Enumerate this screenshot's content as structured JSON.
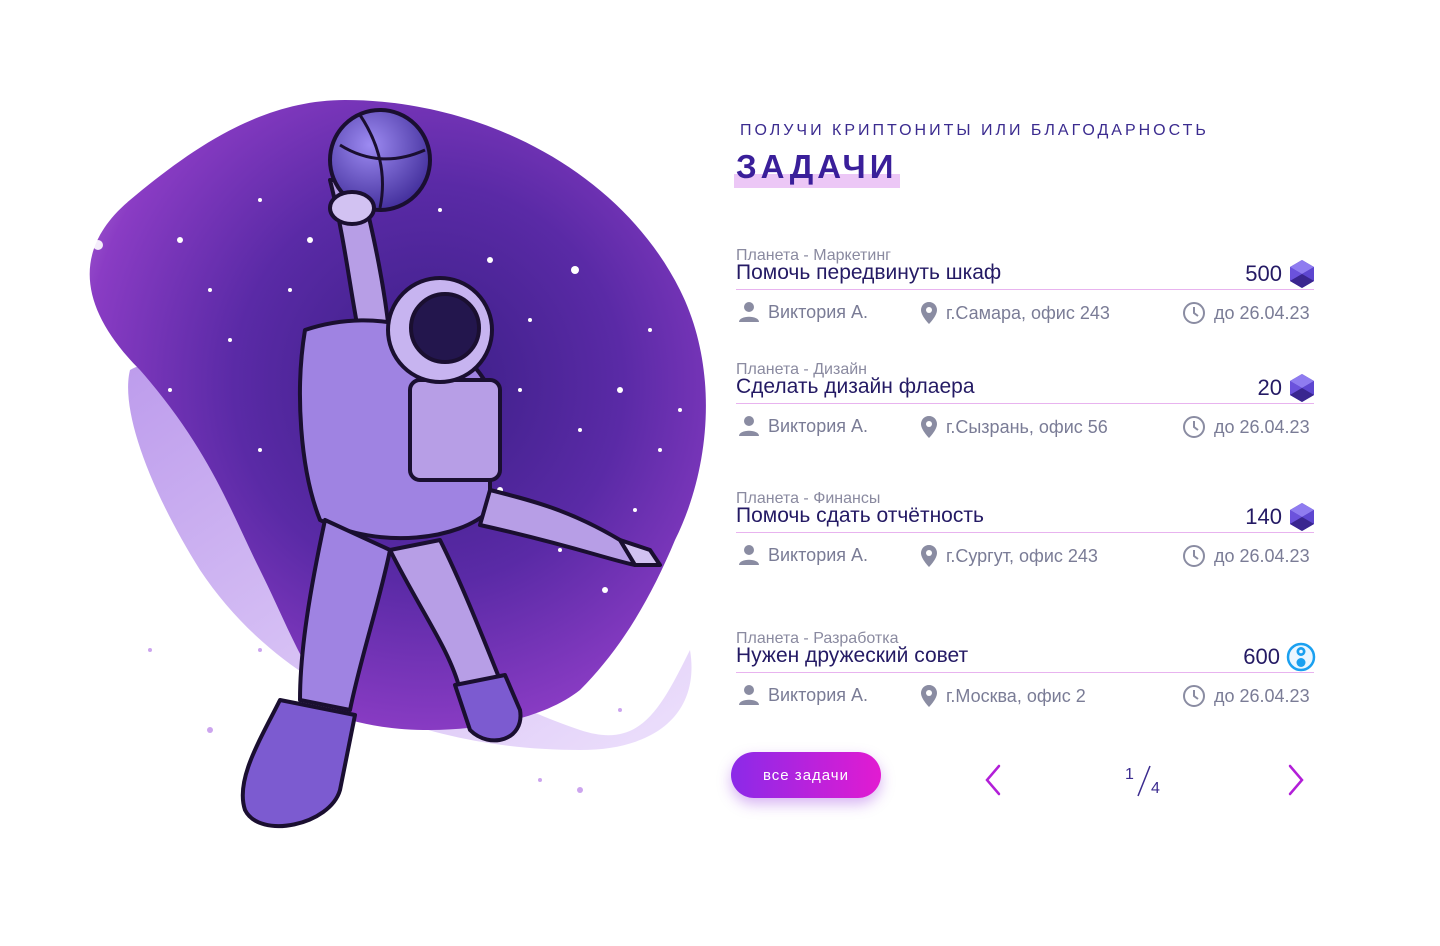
{
  "header": {
    "eyebrow": "ПОЛУЧИ КРИПТОНИТЫ ИЛИ БЛАГОДАРНОСТЬ",
    "title": "ЗАДАЧИ"
  },
  "colors": {
    "accent": "#8b2ae8",
    "accent2": "#e21bd1",
    "title": "#3a1f9a",
    "text": "#241a64",
    "muted": "#7a7c96",
    "rule": "#e8b3ef"
  },
  "tasks": [
    {
      "planet": "Планета - Маркетинг",
      "name": "Помочь передвинуть шкаф",
      "reward": "500",
      "reward_icon": "crystal-icon",
      "author": "Виктория А.",
      "place": "г.Самара, офис 243",
      "deadline": "до 26.04.23"
    },
    {
      "planet": "Планета - Дизайн",
      "name": "Сделать дизайн флаера",
      "reward": "20",
      "reward_icon": "crystal-icon",
      "author": "Виктория А.",
      "place": "г.Сызрань, офис 56",
      "deadline": "до 26.04.23"
    },
    {
      "planet": "Планета - Финансы",
      "name": "Помочь сдать отчётность",
      "reward": "140",
      "reward_icon": "crystal-icon",
      "author": "Виктория А.",
      "place": "г.Сургут, офис 243",
      "deadline": "до 26.04.23"
    },
    {
      "planet": "Планета - Разработка",
      "name": "Нужен дружеский совет",
      "reward": "600",
      "reward_icon": "gratitude-icon",
      "author": "Виктория А.",
      "place": "г.Москва, офис 2",
      "deadline": "до 26.04.23"
    }
  ],
  "footer": {
    "all_tasks_label": "все задачи",
    "page_current": "1",
    "page_total": "4"
  }
}
